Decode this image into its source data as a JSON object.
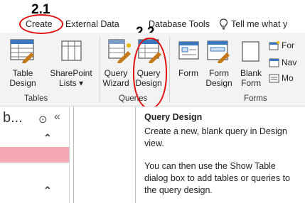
{
  "annotations": {
    "step1": "2.1",
    "step2": "2.2"
  },
  "tabs": [
    {
      "label": "Create"
    },
    {
      "label": "External Data"
    },
    {
      "label": "Database Tools"
    },
    {
      "label": "Tell me what y"
    }
  ],
  "ribbon": {
    "buttons": [
      {
        "line1": "Table",
        "line2": "Design"
      },
      {
        "line1": "SharePoint",
        "line2": "Lists ▾"
      },
      {
        "line1": "Query",
        "line2": "Wizard"
      },
      {
        "line1": "Query",
        "line2": "Design"
      },
      {
        "line1": "Form",
        "line2": ""
      },
      {
        "line1": "Form",
        "line2": "Design"
      },
      {
        "line1": "Blank",
        "line2": "Form"
      }
    ],
    "small": [
      {
        "label": "For"
      },
      {
        "label": "Nav"
      },
      {
        "label": "Mo"
      }
    ],
    "groups": {
      "tables": "Tables",
      "queries": "Queries",
      "forms": "Forms"
    }
  },
  "nav": {
    "title": "b...",
    "chevron": "⊙",
    "collapse": "«",
    "up1": "⌃",
    "up2": "⌃"
  },
  "tooltip": {
    "title": "Query Design",
    "p1": "Create a new, blank query in Design view.",
    "p2": "You can then use the Show Table dialog box to add tables or queries to the query design."
  }
}
